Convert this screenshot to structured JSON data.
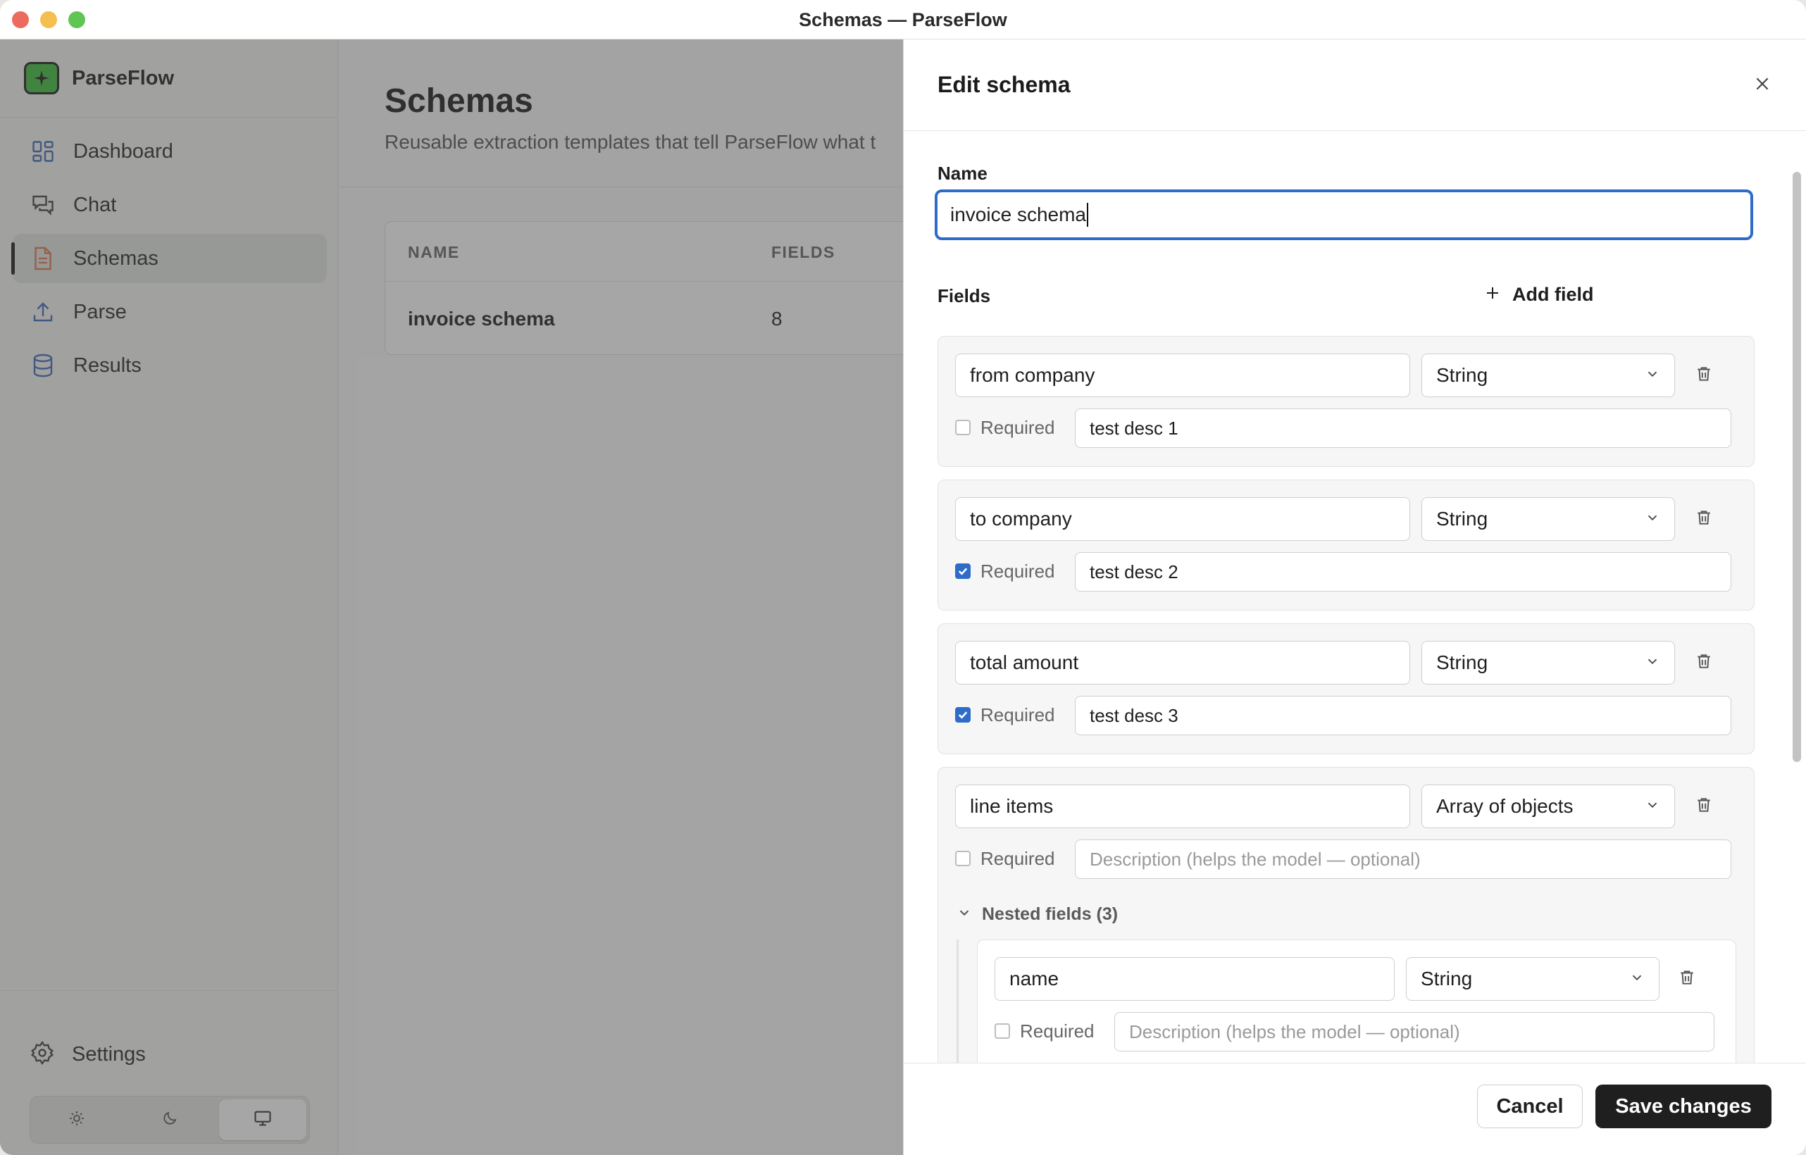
{
  "window": {
    "title": "Schemas — ParseFlow"
  },
  "sidebar": {
    "brand": "ParseFlow",
    "items": [
      {
        "label": "Dashboard",
        "icon": "dashboard-grid-icon"
      },
      {
        "label": "Chat",
        "icon": "chat-bubbles-icon"
      },
      {
        "label": "Schemas",
        "icon": "document-icon",
        "active": true
      },
      {
        "label": "Parse",
        "icon": "upload-icon"
      },
      {
        "label": "Results",
        "icon": "database-icon"
      }
    ],
    "settings_label": "Settings",
    "theme_options": [
      "light",
      "dark",
      "system"
    ],
    "theme_selected": "system"
  },
  "main": {
    "title": "Schemas",
    "subtitle": "Reusable extraction templates that tell ParseFlow what t",
    "table": {
      "columns": [
        "NAME",
        "FIELDS"
      ],
      "rows": [
        {
          "name": "invoice schema",
          "fields": "8"
        }
      ]
    }
  },
  "drawer": {
    "title": "Edit schema",
    "name_label": "Name",
    "name_value": "invoice schema",
    "fields_label": "Fields",
    "add_field_label": "Add field",
    "required_label": "Required",
    "description_placeholder": "Description (helps the model — optional)",
    "fields": [
      {
        "name": "from company",
        "type": "String",
        "required": false,
        "description": "test desc 1"
      },
      {
        "name": "to company",
        "type": "String",
        "required": true,
        "description": "test desc 2"
      },
      {
        "name": "total amount",
        "type": "String",
        "required": true,
        "description": "test desc 3"
      },
      {
        "name": "line items",
        "type": "Array of objects",
        "required": false,
        "description": ""
      }
    ],
    "nested": {
      "label": "Nested fields (3)",
      "fields": [
        {
          "name": "name",
          "type": "String",
          "required": false,
          "description": ""
        }
      ]
    },
    "cancel_label": "Cancel",
    "save_label": "Save changes"
  },
  "colors": {
    "accent": "#2e6cc8",
    "brand": "#3dbf3a",
    "primary_button": "#1f1f1f",
    "schemas_icon": "#e07a4f"
  }
}
